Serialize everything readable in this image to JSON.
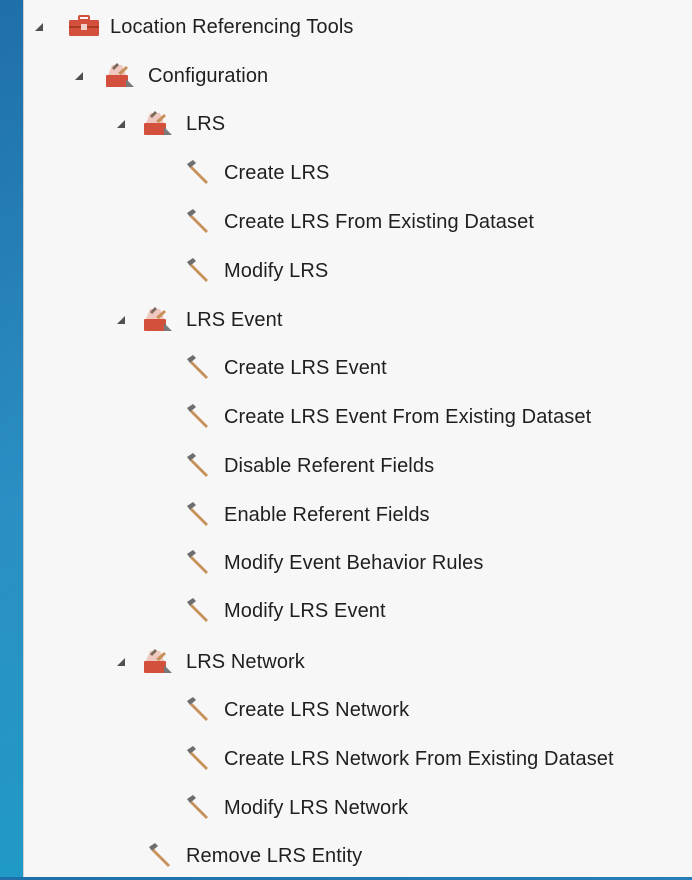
{
  "tree": {
    "root": {
      "label": "Location Referencing Tools",
      "icon": "toolbox-icon",
      "expanded": true,
      "children": [
        {
          "label": "Configuration",
          "icon": "toolset-icon",
          "expanded": true,
          "children": [
            {
              "label": "LRS",
              "icon": "toolset-icon",
              "expanded": true,
              "tools": [
                "Create LRS",
                "Create LRS From Existing Dataset",
                "Modify LRS"
              ]
            },
            {
              "label": "LRS Event",
              "icon": "toolset-icon",
              "expanded": true,
              "tools": [
                "Create LRS Event",
                "Create LRS Event From Existing Dataset",
                "Disable Referent Fields",
                "Enable Referent Fields",
                "Modify Event Behavior Rules",
                "Modify LRS Event"
              ]
            },
            {
              "label": "LRS Network",
              "icon": "toolset-icon",
              "expanded": true,
              "tools": [
                "Create LRS Network",
                "Create LRS Network From Existing Dataset",
                "Modify LRS Network"
              ]
            }
          ],
          "tools": [
            "Remove LRS Entity"
          ]
        }
      ]
    }
  },
  "colors": {
    "background_gradient": [
      "#1f6fa8",
      "#1aa0c8"
    ],
    "panel": "#f7f7f7",
    "text": "#1f1f1f",
    "toolbox_red": "#d2503c",
    "hammer_handle": "#c8915a",
    "hammer_head": "#6e6e6e",
    "expander": "#505050"
  }
}
